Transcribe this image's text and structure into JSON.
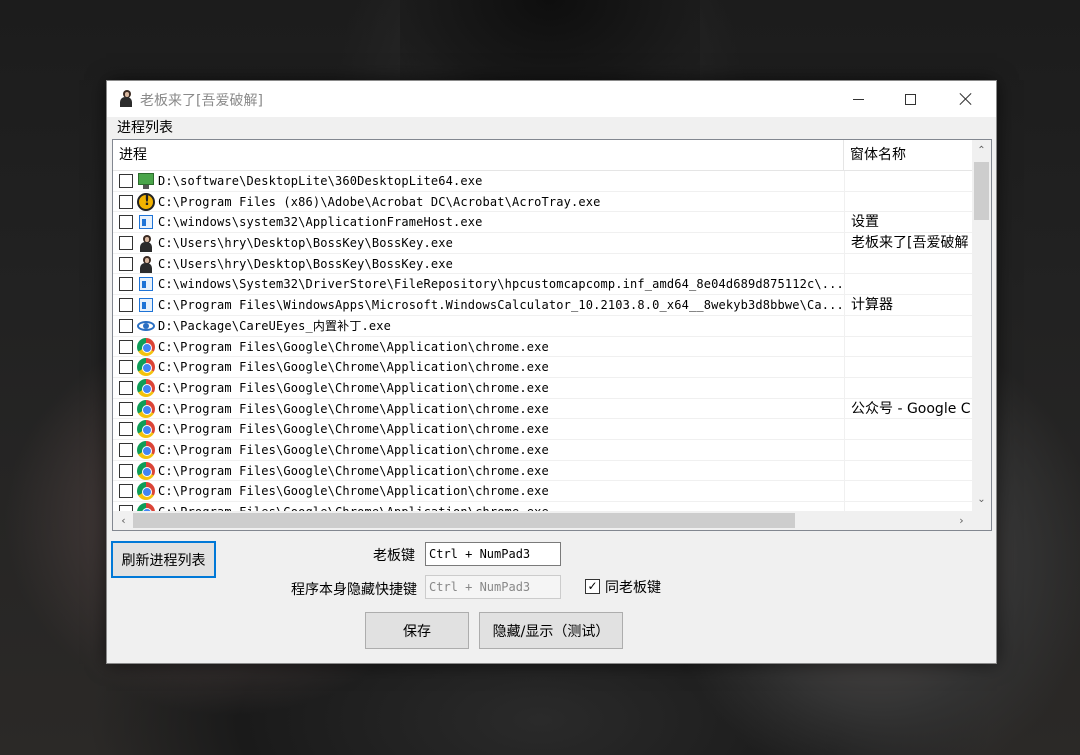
{
  "window": {
    "title": "老板来了[吾爱破解]",
    "min_icon": "minimize-icon",
    "max_icon": "maximize-icon",
    "close_icon": "close-icon"
  },
  "group_label": "进程列表",
  "list": {
    "columns": [
      "进程",
      "窗体名称"
    ],
    "rows": [
      {
        "icon": "monitor-icon",
        "path": "D:\\software\\DesktopLite\\360DesktopLite64.exe",
        "window_name": ""
      },
      {
        "icon": "acrobat-icon",
        "path": "C:\\Program Files (x86)\\Adobe\\Acrobat DC\\Acrobat\\AcroTray.exe",
        "window_name": ""
      },
      {
        "icon": "app-frame-icon",
        "path": "C:\\windows\\system32\\ApplicationFrameHost.exe",
        "window_name": "设置"
      },
      {
        "icon": "bosskey-icon",
        "path": "C:\\Users\\hry\\Desktop\\BossKey\\BossKey.exe",
        "window_name": "老板来了[吾爱破解"
      },
      {
        "icon": "bosskey-icon",
        "path": "C:\\Users\\hry\\Desktop\\BossKey\\BossKey.exe",
        "window_name": ""
      },
      {
        "icon": "app-frame-icon",
        "path": "C:\\windows\\System32\\DriverStore\\FileRepository\\hpcustomcapcomp.inf_amd64_8e04d689d875112c\\...",
        "window_name": ""
      },
      {
        "icon": "app-frame-icon",
        "path": "C:\\Program Files\\WindowsApps\\Microsoft.WindowsCalculator_10.2103.8.0_x64__8wekyb3d8bbwe\\Ca...",
        "window_name": "计算器"
      },
      {
        "icon": "eye-icon",
        "path": "D:\\Package\\CareUEyes_内置补丁.exe",
        "window_name": ""
      },
      {
        "icon": "chrome-icon",
        "path": "C:\\Program Files\\Google\\Chrome\\Application\\chrome.exe",
        "window_name": ""
      },
      {
        "icon": "chrome-icon",
        "path": "C:\\Program Files\\Google\\Chrome\\Application\\chrome.exe",
        "window_name": ""
      },
      {
        "icon": "chrome-icon",
        "path": "C:\\Program Files\\Google\\Chrome\\Application\\chrome.exe",
        "window_name": ""
      },
      {
        "icon": "chrome-icon",
        "path": "C:\\Program Files\\Google\\Chrome\\Application\\chrome.exe",
        "window_name": "公众号 - Google C"
      },
      {
        "icon": "chrome-icon",
        "path": "C:\\Program Files\\Google\\Chrome\\Application\\chrome.exe",
        "window_name": ""
      },
      {
        "icon": "chrome-icon",
        "path": "C:\\Program Files\\Google\\Chrome\\Application\\chrome.exe",
        "window_name": ""
      },
      {
        "icon": "chrome-icon",
        "path": "C:\\Program Files\\Google\\Chrome\\Application\\chrome.exe",
        "window_name": ""
      },
      {
        "icon": "chrome-icon",
        "path": "C:\\Program Files\\Google\\Chrome\\Application\\chrome.exe",
        "window_name": ""
      },
      {
        "icon": "chrome-icon",
        "path": "C:\\Program Files\\Google\\Chrome\\Application\\chrome.exe",
        "window_name": ""
      }
    ]
  },
  "controls": {
    "refresh_button": "刷新进程列表",
    "boss_key_label": "老板键",
    "boss_key_value": "Ctrl + NumPad3",
    "self_hide_label": "程序本身隐藏快捷键",
    "self_hide_value": "Ctrl + NumPad3",
    "same_as_boss_label": "同老板键",
    "same_as_boss_checked": "✓",
    "save_button": "保存",
    "toggle_button": "隐藏/显示（测试）"
  },
  "colors": {
    "accent": "#0078d7"
  }
}
